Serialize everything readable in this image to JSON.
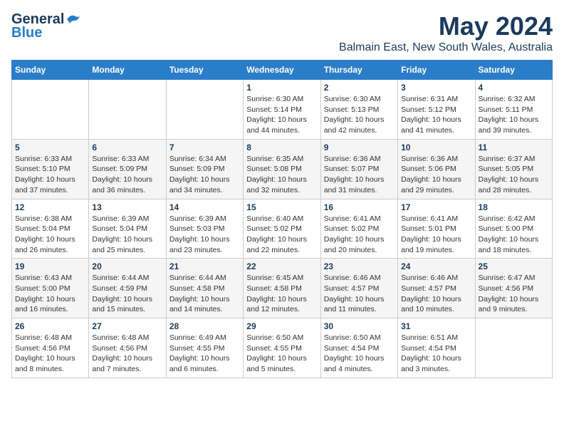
{
  "header": {
    "logo_line1": "General",
    "logo_line2": "Blue",
    "title": "May 2024",
    "subtitle": "Balmain East, New South Wales, Australia"
  },
  "calendar": {
    "days_of_week": [
      "Sunday",
      "Monday",
      "Tuesday",
      "Wednesday",
      "Thursday",
      "Friday",
      "Saturday"
    ],
    "weeks": [
      [
        {
          "day": "",
          "info": ""
        },
        {
          "day": "",
          "info": ""
        },
        {
          "day": "",
          "info": ""
        },
        {
          "day": "1",
          "info": "Sunrise: 6:30 AM\nSunset: 5:14 PM\nDaylight: 10 hours\nand 44 minutes."
        },
        {
          "day": "2",
          "info": "Sunrise: 6:30 AM\nSunset: 5:13 PM\nDaylight: 10 hours\nand 42 minutes."
        },
        {
          "day": "3",
          "info": "Sunrise: 6:31 AM\nSunset: 5:12 PM\nDaylight: 10 hours\nand 41 minutes."
        },
        {
          "day": "4",
          "info": "Sunrise: 6:32 AM\nSunset: 5:11 PM\nDaylight: 10 hours\nand 39 minutes."
        }
      ],
      [
        {
          "day": "5",
          "info": "Sunrise: 6:33 AM\nSunset: 5:10 PM\nDaylight: 10 hours\nand 37 minutes."
        },
        {
          "day": "6",
          "info": "Sunrise: 6:33 AM\nSunset: 5:09 PM\nDaylight: 10 hours\nand 36 minutes."
        },
        {
          "day": "7",
          "info": "Sunrise: 6:34 AM\nSunset: 5:09 PM\nDaylight: 10 hours\nand 34 minutes."
        },
        {
          "day": "8",
          "info": "Sunrise: 6:35 AM\nSunset: 5:08 PM\nDaylight: 10 hours\nand 32 minutes."
        },
        {
          "day": "9",
          "info": "Sunrise: 6:36 AM\nSunset: 5:07 PM\nDaylight: 10 hours\nand 31 minutes."
        },
        {
          "day": "10",
          "info": "Sunrise: 6:36 AM\nSunset: 5:06 PM\nDaylight: 10 hours\nand 29 minutes."
        },
        {
          "day": "11",
          "info": "Sunrise: 6:37 AM\nSunset: 5:05 PM\nDaylight: 10 hours\nand 28 minutes."
        }
      ],
      [
        {
          "day": "12",
          "info": "Sunrise: 6:38 AM\nSunset: 5:04 PM\nDaylight: 10 hours\nand 26 minutes."
        },
        {
          "day": "13",
          "info": "Sunrise: 6:39 AM\nSunset: 5:04 PM\nDaylight: 10 hours\nand 25 minutes."
        },
        {
          "day": "14",
          "info": "Sunrise: 6:39 AM\nSunset: 5:03 PM\nDaylight: 10 hours\nand 23 minutes."
        },
        {
          "day": "15",
          "info": "Sunrise: 6:40 AM\nSunset: 5:02 PM\nDaylight: 10 hours\nand 22 minutes."
        },
        {
          "day": "16",
          "info": "Sunrise: 6:41 AM\nSunset: 5:02 PM\nDaylight: 10 hours\nand 20 minutes."
        },
        {
          "day": "17",
          "info": "Sunrise: 6:41 AM\nSunset: 5:01 PM\nDaylight: 10 hours\nand 19 minutes."
        },
        {
          "day": "18",
          "info": "Sunrise: 6:42 AM\nSunset: 5:00 PM\nDaylight: 10 hours\nand 18 minutes."
        }
      ],
      [
        {
          "day": "19",
          "info": "Sunrise: 6:43 AM\nSunset: 5:00 PM\nDaylight: 10 hours\nand 16 minutes."
        },
        {
          "day": "20",
          "info": "Sunrise: 6:44 AM\nSunset: 4:59 PM\nDaylight: 10 hours\nand 15 minutes."
        },
        {
          "day": "21",
          "info": "Sunrise: 6:44 AM\nSunset: 4:58 PM\nDaylight: 10 hours\nand 14 minutes."
        },
        {
          "day": "22",
          "info": "Sunrise: 6:45 AM\nSunset: 4:58 PM\nDaylight: 10 hours\nand 12 minutes."
        },
        {
          "day": "23",
          "info": "Sunrise: 6:46 AM\nSunset: 4:57 PM\nDaylight: 10 hours\nand 11 minutes."
        },
        {
          "day": "24",
          "info": "Sunrise: 6:46 AM\nSunset: 4:57 PM\nDaylight: 10 hours\nand 10 minutes."
        },
        {
          "day": "25",
          "info": "Sunrise: 6:47 AM\nSunset: 4:56 PM\nDaylight: 10 hours\nand 9 minutes."
        }
      ],
      [
        {
          "day": "26",
          "info": "Sunrise: 6:48 AM\nSunset: 4:56 PM\nDaylight: 10 hours\nand 8 minutes."
        },
        {
          "day": "27",
          "info": "Sunrise: 6:48 AM\nSunset: 4:56 PM\nDaylight: 10 hours\nand 7 minutes."
        },
        {
          "day": "28",
          "info": "Sunrise: 6:49 AM\nSunset: 4:55 PM\nDaylight: 10 hours\nand 6 minutes."
        },
        {
          "day": "29",
          "info": "Sunrise: 6:50 AM\nSunset: 4:55 PM\nDaylight: 10 hours\nand 5 minutes."
        },
        {
          "day": "30",
          "info": "Sunrise: 6:50 AM\nSunset: 4:54 PM\nDaylight: 10 hours\nand 4 minutes."
        },
        {
          "day": "31",
          "info": "Sunrise: 6:51 AM\nSunset: 4:54 PM\nDaylight: 10 hours\nand 3 minutes."
        },
        {
          "day": "",
          "info": ""
        }
      ]
    ]
  }
}
